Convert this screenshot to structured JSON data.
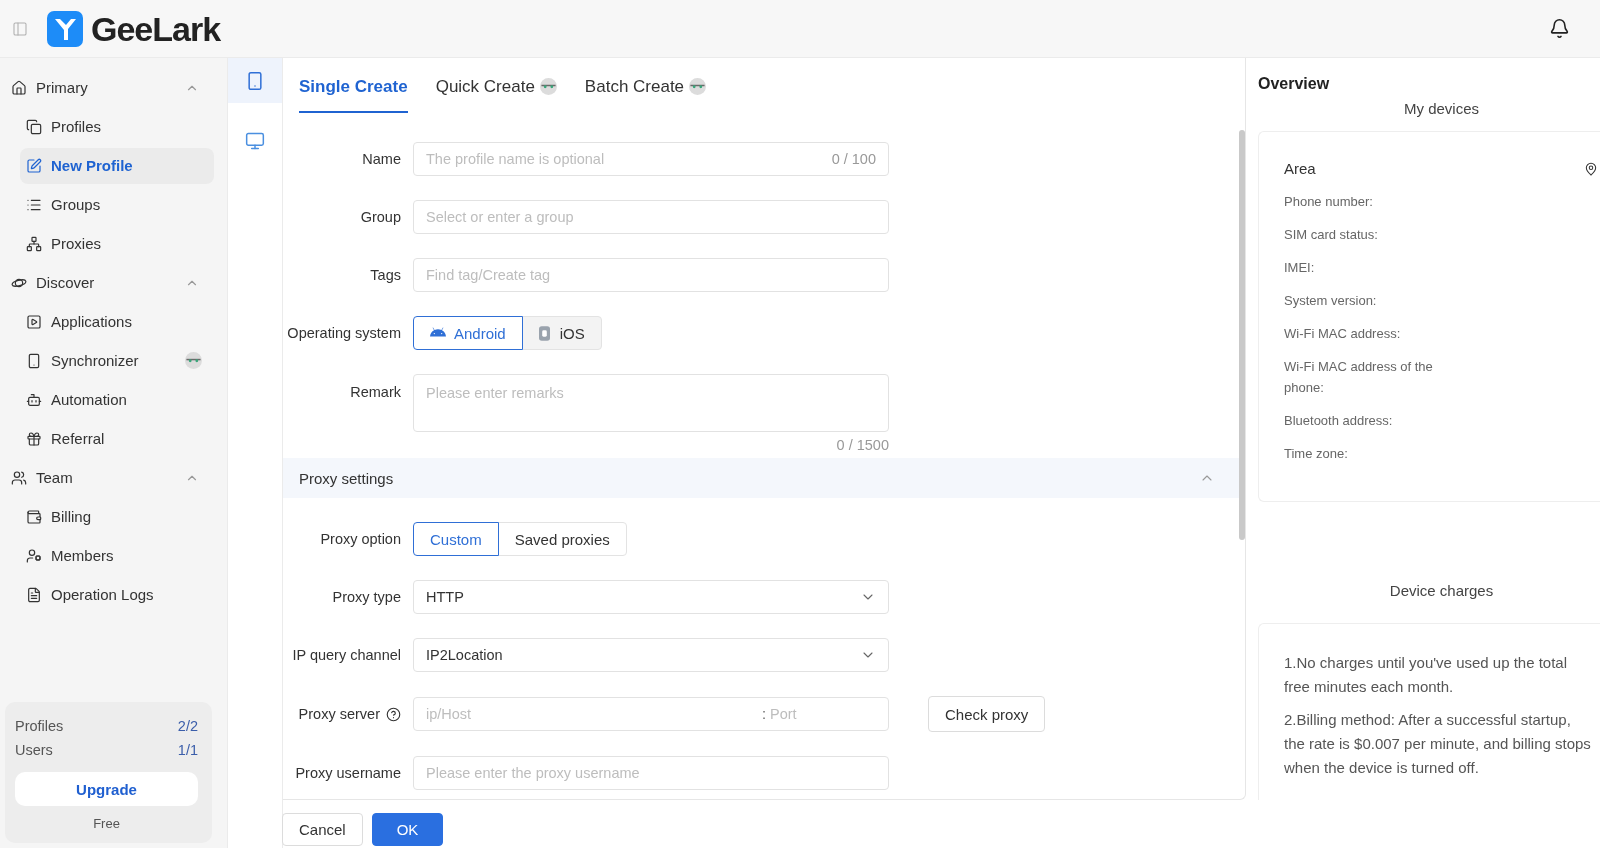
{
  "header": {
    "logo": "GeeLark"
  },
  "sidebar": {
    "sections": [
      {
        "label": "Primary",
        "expanded": true,
        "items": [
          {
            "label": "Profiles",
            "selected": false,
            "badge": false
          },
          {
            "label": "New Profile",
            "selected": true,
            "badge": false
          },
          {
            "label": "Groups",
            "selected": false,
            "badge": false
          },
          {
            "label": "Proxies",
            "selected": false,
            "badge": false
          }
        ]
      },
      {
        "label": "Discover",
        "expanded": true,
        "items": [
          {
            "label": "Applications",
            "selected": false,
            "badge": false
          },
          {
            "label": "Synchronizer",
            "selected": false,
            "badge": true
          },
          {
            "label": "Automation",
            "selected": false,
            "badge": false
          },
          {
            "label": "Referral",
            "selected": false,
            "badge": false
          }
        ]
      },
      {
        "label": "Team",
        "expanded": true,
        "items": [
          {
            "label": "Billing",
            "selected": false,
            "badge": false
          },
          {
            "label": "Members",
            "selected": false,
            "badge": false
          },
          {
            "label": "Operation Logs",
            "selected": false,
            "badge": false
          }
        ]
      }
    ],
    "usage": [
      {
        "label": "Profiles",
        "value": "2/2"
      },
      {
        "label": "Users",
        "value": "1/1"
      }
    ],
    "upgrade_button": "Upgrade",
    "plan": "Free"
  },
  "device_types": [
    {
      "kind": "phone",
      "selected": true
    },
    {
      "kind": "desktop",
      "selected": false
    }
  ],
  "tabs": [
    {
      "label": "Single Create",
      "selected": true,
      "badge": false
    },
    {
      "label": "Quick Create",
      "selected": false,
      "badge": true
    },
    {
      "label": "Batch Create",
      "selected": false,
      "badge": true
    }
  ],
  "form": {
    "rows": [
      {
        "kind": "text",
        "label": "Name",
        "placeholder": "The profile name is optional",
        "counter": "0 / 100"
      },
      {
        "kind": "text",
        "label": "Group",
        "placeholder": "Select or enter a group"
      },
      {
        "kind": "text",
        "label": "Tags",
        "placeholder": "Find tag/Create tag"
      },
      {
        "kind": "os",
        "label": "Operating system",
        "options": [
          {
            "label": "Android",
            "selected": true
          },
          {
            "label": "iOS",
            "selected": false
          }
        ]
      },
      {
        "kind": "textarea",
        "label": "Remark",
        "placeholder": "Please enter remarks",
        "counter": "0 / 1500"
      }
    ],
    "proxy_section": {
      "title": "Proxy settings",
      "expanded": true,
      "rows": [
        {
          "kind": "segmented",
          "label": "Proxy option",
          "options": [
            {
              "label": "Custom",
              "selected": true
            },
            {
              "label": "Saved proxies",
              "selected": false
            }
          ]
        },
        {
          "kind": "select",
          "label": "Proxy type",
          "value": "HTTP"
        },
        {
          "kind": "select",
          "label": "IP query channel",
          "value": "IP2Location"
        },
        {
          "kind": "server",
          "label": "Proxy server",
          "help": true,
          "placeholder": "ip/Host",
          "separator": ":",
          "port_placeholder": "Port",
          "button": "Check proxy"
        },
        {
          "kind": "text",
          "label": "Proxy username",
          "placeholder": "Please enter the proxy username"
        }
      ]
    }
  },
  "footer_buttons": [
    {
      "label": "Cancel",
      "kind": "secondary"
    },
    {
      "label": "OK",
      "kind": "primary"
    }
  ],
  "overview": {
    "title": "Overview",
    "devices": {
      "title": "My devices",
      "area": "Area",
      "fields": [
        "Phone number:",
        "SIM card status:",
        "IMEI:",
        "System version:",
        "Wi-Fi MAC address:",
        "Wi-Fi MAC address of the phone:",
        "Bluetooth address:",
        "Time zone:"
      ]
    },
    "charges": {
      "title": "Device charges",
      "notes": [
        "1.No charges until you've used up the total free minutes each month.",
        "2.Billing method: After a successful startup, the rate is $0.007 per minute, and billing stops when the device is turned off."
      ]
    }
  }
}
